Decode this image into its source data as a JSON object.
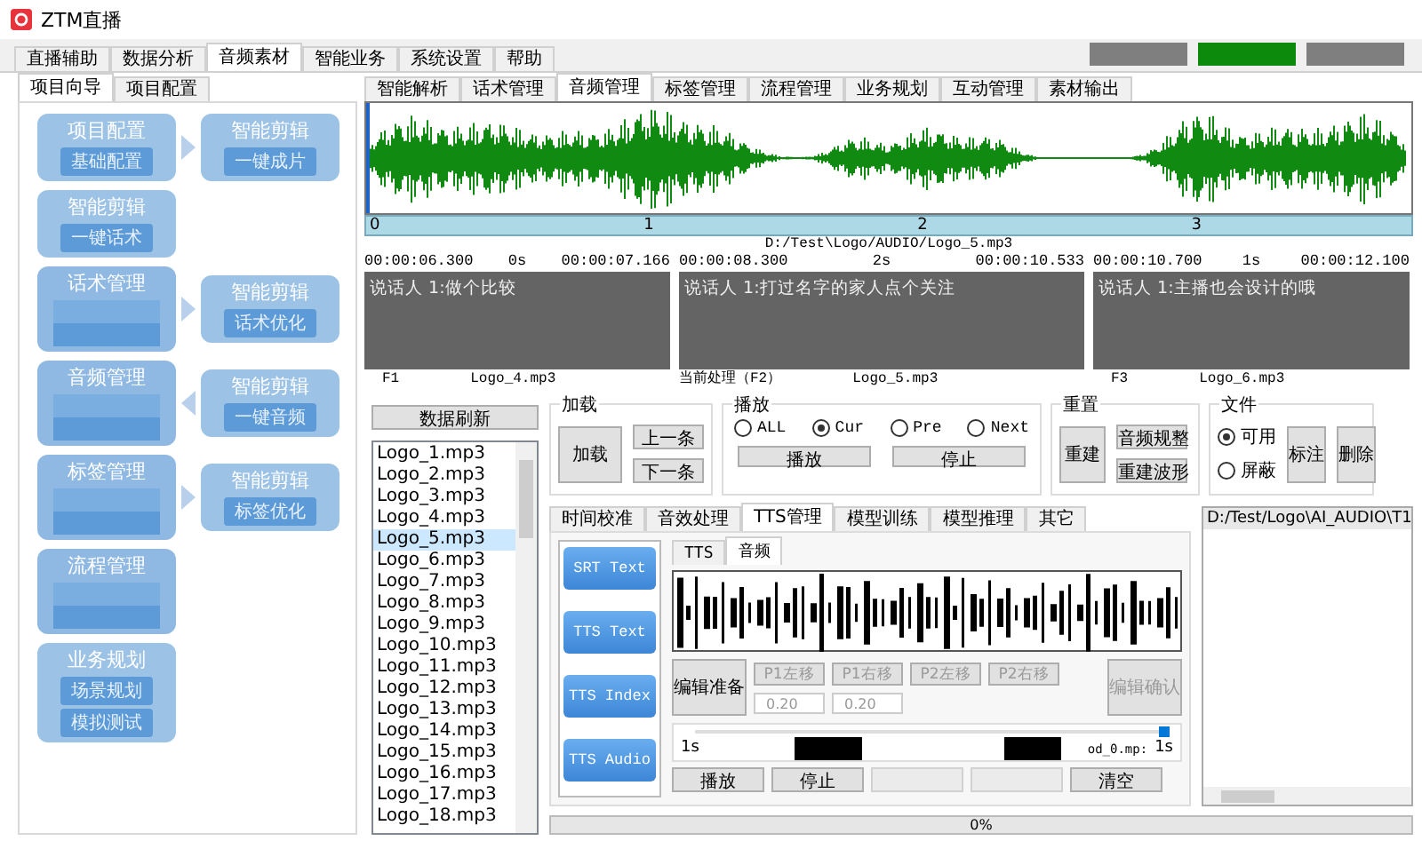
{
  "app": {
    "title": "ZTM直播"
  },
  "top_tabs": [
    {
      "label": "直播辅助",
      "selected": false
    },
    {
      "label": "数据分析",
      "selected": false
    },
    {
      "label": "音频素材",
      "selected": true
    },
    {
      "label": "智能业务",
      "selected": false
    },
    {
      "label": "系统设置",
      "selected": false
    },
    {
      "label": "帮助",
      "selected": false
    }
  ],
  "status_bars": [
    {
      "color": "#7f7f7f"
    },
    {
      "color": "#0b8a0b"
    },
    {
      "color": "#7f7f7f"
    }
  ],
  "left_tabs": [
    {
      "label": "项目向导",
      "selected": true
    },
    {
      "label": "项目配置",
      "selected": false
    }
  ],
  "flow_rows": [
    {
      "main": {
        "title": "项目配置",
        "buttons": [
          "基础配置"
        ],
        "kind": "clear"
      },
      "side": {
        "title": "智能剪辑",
        "buttons": [
          "一键成片"
        ]
      },
      "points_left": false
    },
    {
      "main": {
        "title": "智能剪辑",
        "buttons": [
          "一键话术"
        ],
        "kind": "clear"
      }
    },
    {
      "main": {
        "title": "话术管理",
        "kind": "blurred"
      },
      "side": {
        "title": "智能剪辑",
        "buttons": [
          "话术优化"
        ]
      },
      "points_left": false
    },
    {
      "main": {
        "title": "音频管理",
        "kind": "blurred"
      },
      "side": {
        "title": "智能剪辑",
        "buttons": [
          "一键音频"
        ]
      },
      "points_left": true
    },
    {
      "main": {
        "title": "标签管理",
        "kind": "blurred"
      },
      "side": {
        "title": "智能剪辑",
        "buttons": [
          "标签优化"
        ]
      },
      "points_left": false
    },
    {
      "main": {
        "title": "流程管理",
        "kind": "blurred"
      }
    },
    {
      "main": {
        "title": "业务规划",
        "buttons": [
          "场景规划",
          "模拟测试"
        ],
        "kind": "clear"
      }
    }
  ],
  "audio_tabs": [
    {
      "label": "智能解析",
      "selected": false
    },
    {
      "label": "话术管理",
      "selected": false
    },
    {
      "label": "音频管理",
      "selected": true
    },
    {
      "label": "标签管理",
      "selected": false
    },
    {
      "label": "流程管理",
      "selected": false
    },
    {
      "label": "业务规划",
      "selected": false
    },
    {
      "label": "互动管理",
      "selected": false
    },
    {
      "label": "素材输出",
      "selected": false
    }
  ],
  "waveform": {
    "ticks": [
      "0",
      "1",
      "2",
      "3"
    ],
    "path": "D:/Test\\Logo/AUDIO/Logo_5.mp3"
  },
  "segments": [
    {
      "start": "00:00:06.300",
      "duration": "0s",
      "end": "00:00:07.166",
      "text": "说话人 1:做个比较",
      "slot": "F1",
      "file": "Logo_4.mp3"
    },
    {
      "start": "00:00:08.300",
      "duration": "2s",
      "end": "00:00:10.533",
      "text": "说话人 1:打过名字的家人点个关注",
      "slot": "当前处理（F2）",
      "file": "Logo_5.mp3"
    },
    {
      "start": "00:00:10.700",
      "duration": "1s",
      "end": "00:00:12.100",
      "text": "说话人 1:主播也会设计的哦",
      "slot": "F3",
      "file": "Logo_6.mp3"
    }
  ],
  "refresh_button": "数据刷新",
  "file_list": [
    {
      "name": "Logo_1.mp3",
      "selected": false
    },
    {
      "name": "Logo_2.mp3",
      "selected": false
    },
    {
      "name": "Logo_3.mp3",
      "selected": false
    },
    {
      "name": "Logo_4.mp3",
      "selected": false
    },
    {
      "name": "Logo_5.mp3",
      "selected": true
    },
    {
      "name": "Logo_6.mp3",
      "selected": false
    },
    {
      "name": "Logo_7.mp3",
      "selected": false
    },
    {
      "name": "Logo_8.mp3",
      "selected": false
    },
    {
      "name": "Logo_9.mp3",
      "selected": false
    },
    {
      "name": "Logo_10.mp3",
      "selected": false
    },
    {
      "name": "Logo_11.mp3",
      "selected": false
    },
    {
      "name": "Logo_12.mp3",
      "selected": false
    },
    {
      "name": "Logo_13.mp3",
      "selected": false
    },
    {
      "name": "Logo_14.mp3",
      "selected": false
    },
    {
      "name": "Logo_15.mp3",
      "selected": false
    },
    {
      "name": "Logo_16.mp3",
      "selected": false
    },
    {
      "name": "Logo_17.mp3",
      "selected": false
    },
    {
      "name": "Logo_18.mp3",
      "selected": false
    }
  ],
  "load_group": {
    "title": "加载",
    "main": "加载",
    "buttons": [
      "上一条",
      "下一条"
    ]
  },
  "play_group": {
    "title": "播放",
    "options": [
      {
        "label": "ALL",
        "selected": false
      },
      {
        "label": "Cur",
        "selected": true
      },
      {
        "label": "Pre",
        "selected": false
      },
      {
        "label": "Next",
        "selected": false
      }
    ],
    "buttons": [
      "播放",
      "停止"
    ]
  },
  "reset_group": {
    "title": "重置",
    "main": "重建",
    "buttons": [
      "音频规整",
      "重建波形"
    ]
  },
  "file_group": {
    "title": "文件",
    "options": [
      {
        "label": "可用",
        "selected": true
      },
      {
        "label": "屏蔽",
        "selected": false
      }
    ],
    "buttons": [
      "标注",
      "删除"
    ]
  },
  "inner_tabs": [
    {
      "label": "时间校准",
      "selected": false
    },
    {
      "label": "音效处理",
      "selected": false
    },
    {
      "label": "TTS管理",
      "selected": true
    },
    {
      "label": "模型训练",
      "selected": false
    },
    {
      "label": "模型推理",
      "selected": false
    },
    {
      "label": "其它",
      "selected": false
    }
  ],
  "flow_buttons": [
    "SRT Text",
    "TTS Text",
    "TTS Index",
    "TTS Audio"
  ],
  "tts_tabs": [
    {
      "label": "TTS",
      "selected": false
    },
    {
      "label": "音频",
      "selected": true
    }
  ],
  "edit": {
    "prepare": "编辑准备",
    "shifts": [
      "P1左移",
      "P1右移",
      "P2左移",
      "P2右移"
    ],
    "spins": [
      "0.20",
      "0.20"
    ],
    "confirm": "编辑确认"
  },
  "slider": {
    "left": "1s",
    "file": "od_0.mp:",
    "right": "1s",
    "level": 1
  },
  "action_buttons": [
    {
      "kind": "text",
      "label": "播放"
    },
    {
      "kind": "text",
      "label": "停止"
    },
    {
      "kind": "blurred"
    },
    {
      "kind": "blurred"
    },
    {
      "kind": "text",
      "label": "清空"
    }
  ],
  "path_list": {
    "header": "D:/Test/Logo\\AI_AUDIO\\T1"
  },
  "progress": {
    "label": "0%",
    "level": 0
  }
}
